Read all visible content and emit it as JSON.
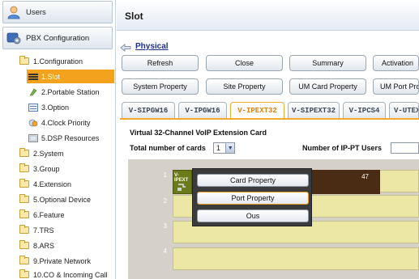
{
  "nav": {
    "users": "Users",
    "pbx_configuration": "PBX Configuration",
    "items": [
      {
        "label": "1.Configuration",
        "level": 0,
        "open": true
      },
      {
        "label": "1.Slot",
        "level": 1,
        "selected": true
      },
      {
        "label": "2.Portable Station",
        "level": 1
      },
      {
        "label": "3.Option",
        "level": 1
      },
      {
        "label": "4.Clock Priority",
        "level": 1
      },
      {
        "label": "5.DSP Resources",
        "level": 1
      },
      {
        "label": "2.System",
        "level": 0
      },
      {
        "label": "3.Group",
        "level": 0
      },
      {
        "label": "4.Extension",
        "level": 0
      },
      {
        "label": "5.Optional Device",
        "level": 0
      },
      {
        "label": "6.Feature",
        "level": 0
      },
      {
        "label": "7.TRS",
        "level": 0
      },
      {
        "label": "8.ARS",
        "level": 0
      },
      {
        "label": "9.Private Network",
        "level": 0
      },
      {
        "label": "10.CO & Incoming Call",
        "level": 0
      }
    ]
  },
  "header": {
    "title": "Slot"
  },
  "breadcrumb": {
    "physical": "Physical"
  },
  "toolbar_row1": [
    "Refresh",
    "Close",
    "Summary",
    "Activation"
  ],
  "toolbar_row2": [
    "System Property",
    "Site Property",
    "UM Card Property",
    "UM Port Property"
  ],
  "tabs": [
    "V-SIPGW16",
    "V-IPGW16",
    "V-IPEXT32",
    "V-SIPEXT32",
    "V-IPCS4",
    "V-UTEXT"
  ],
  "active_tab": "V-IPEXT32",
  "card": {
    "title": "Virtual 32-Channel VoIP Extension Card",
    "total_cards_label": "Total number of cards",
    "total_cards_value": "1",
    "ip_pt_users_label": "Number of IP-PT Users",
    "ip_pt_users_value": ""
  },
  "slots": [
    {
      "number": "1",
      "card_label": "V-IPEXT",
      "count": "47"
    },
    {
      "number": "2"
    },
    {
      "number": "3"
    },
    {
      "number": "4"
    }
  ],
  "popup": {
    "items": [
      "Card Property",
      "Port Property",
      "Ous"
    ],
    "highlighted": "Port Property"
  },
  "colors": {
    "selection": "#f3a21e",
    "active_tab": "#e07f0e",
    "slot_fill": "#ece7a4",
    "card_dark": "#4a2c14",
    "link": "#1c2f8c"
  }
}
